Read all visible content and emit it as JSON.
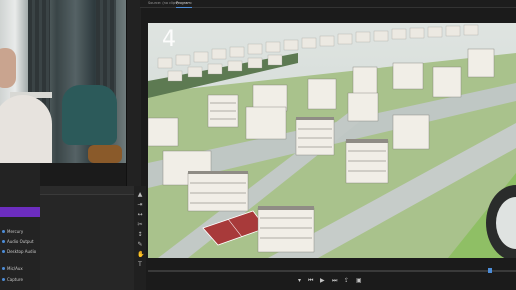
{
  "program": {
    "header_tabs": [
      "Source: (no clips)",
      "Program: ",
      ""
    ],
    "overlay_number": "4",
    "caption": "",
    "timecode": ""
  },
  "project_panel": {
    "tabs": [
      "",
      "",
      "",
      ""
    ]
  },
  "timeline": {
    "tracks": [
      "Mercury",
      "Audio Output",
      "Desktop Audio",
      "Mic/Aux",
      "Capture"
    ]
  },
  "colors": {
    "accent": "#4d8dd8",
    "purple_bar": "#6c2dbf",
    "lawn": "#8fbf65",
    "road": "#b9c2bf"
  },
  "icons": [
    "play-icon",
    "step-back-icon",
    "step-forward-icon",
    "selection-tool-icon",
    "razor-tool-icon",
    "hand-tool-icon",
    "text-tool-icon"
  ]
}
